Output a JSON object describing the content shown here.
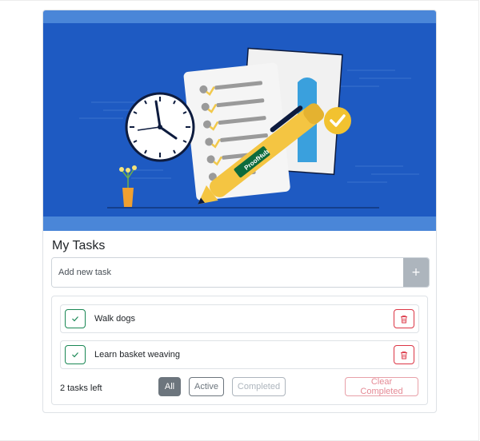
{
  "header": {
    "title": "My Tasks"
  },
  "new_task": {
    "placeholder": "Add new task",
    "value": "",
    "add_label": "+"
  },
  "tasks": [
    {
      "label": "Walk dogs",
      "completed": false
    },
    {
      "label": "Learn basket weaving",
      "completed": false
    }
  ],
  "footer": {
    "tasks_left": "2 tasks left",
    "filters": [
      "All",
      "Active",
      "Completed"
    ],
    "selected_filter": "All",
    "clear_label": "Clear Completed"
  },
  "illustration": {
    "brand_text": "ProofHub"
  },
  "colors": {
    "hero_blue": "#1e5ac2",
    "hero_band": "#4a86d8",
    "success": "#198754",
    "danger": "#dc3545",
    "secondary": "#6c757d"
  }
}
